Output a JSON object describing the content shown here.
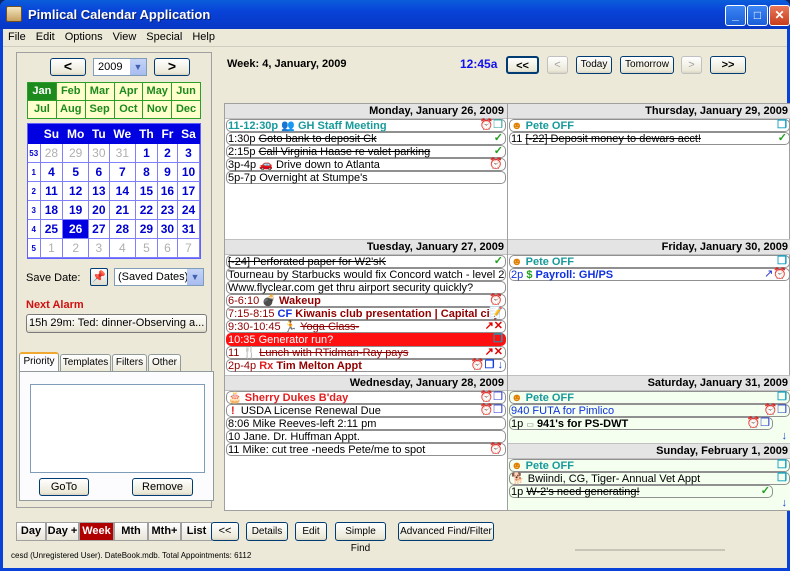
{
  "window": {
    "title": "Pimlical Calendar Application",
    "minimize": "_",
    "maximize": "□",
    "close": "✕"
  },
  "menu": [
    "File",
    "Edit",
    "Options",
    "View",
    "Special",
    "Help"
  ],
  "left": {
    "year": "2009",
    "prev": "<",
    "next": ">",
    "months": [
      "Jan",
      "Feb",
      "Mar",
      "Apr",
      "May",
      "Jun",
      "Jul",
      "Aug",
      "Sep",
      "Oct",
      "Nov",
      "Dec"
    ],
    "selected_month": "Jan",
    "weekday_headers": [
      "Su",
      "Mo",
      "Tu",
      "We",
      "Th",
      "Fr",
      "Sa"
    ],
    "weeks": [
      {
        "wk": "53",
        "days": [
          "28",
          "29",
          "30",
          "31",
          "1",
          "2",
          "3"
        ]
      },
      {
        "wk": "1",
        "days": [
          "4",
          "5",
          "6",
          "7",
          "8",
          "9",
          "10"
        ]
      },
      {
        "wk": "2",
        "days": [
          "11",
          "12",
          "13",
          "14",
          "15",
          "16",
          "17"
        ]
      },
      {
        "wk": "3",
        "days": [
          "18",
          "19",
          "20",
          "21",
          "22",
          "23",
          "24"
        ]
      },
      {
        "wk": "4",
        "days": [
          "25",
          "26",
          "27",
          "28",
          "29",
          "30",
          "31"
        ]
      },
      {
        "wk": "5",
        "days": [
          "1",
          "2",
          "3",
          "4",
          "5",
          "6",
          "7"
        ]
      }
    ],
    "selected_day": "26",
    "save_date_label": "Save Date:",
    "saved_dates": "(Saved Dates)",
    "next_alarm_label": "Next Alarm",
    "next_alarm_value": "15h 29m:  Ted: dinner-Observing a...",
    "tabs": [
      "Priority",
      "Templates",
      "Filters",
      "Other"
    ],
    "active_tab": "Priority",
    "goto": "GoTo",
    "remove": "Remove"
  },
  "header": {
    "week": "Week: 4,  January, 2009",
    "time": "12:45a",
    "nav": {
      "first": "<<",
      "prev": "<",
      "today": "Today",
      "tomorrow": "Tomorrow",
      "next": ">",
      "last": ">>"
    }
  },
  "days": {
    "mon": {
      "title": "Monday, January 26, 2009",
      "appts": [
        {
          "text": "11-12:30p 👥 GH Staff Meeting",
          "icons": "⏰❐"
        },
        {
          "time": "1:30p",
          "text": "Goto bank to deposit Ck",
          "icons": "✓"
        },
        {
          "time": "2:15p",
          "text": "Call Virginia Haase re valet parking",
          "icons": "✓"
        },
        {
          "text": "3p-4p 🚗 Drive down to Atlanta",
          "icons": "⏰"
        },
        {
          "text": "5p-7p Overnight at Stumpe's",
          "icons": ""
        }
      ]
    },
    "tue": {
      "title": "Tuesday, January 27, 2009",
      "appts": [
        {
          "text": "[-24] Perforated paper for W2'sK",
          "icons": "✓"
        },
        {
          "text": "Tourneau by Starbucks would fix Concord watch - level 2",
          "icons": ""
        },
        {
          "text": "Www.flyclear.com get thru airport security quickly?",
          "icons": ""
        },
        {
          "time": "6-6:10",
          "text": "Wakeup",
          "icons": "⏰"
        },
        {
          "time": "7:15-8:15",
          "badge": "CF",
          "text": "Kiwanis club presentation | Capital city",
          "icons": "📝"
        },
        {
          "time": "9:30-10:45",
          "text": "Yoga Class-",
          "icons": "↗✕"
        },
        {
          "text": "10:35 Generator run?",
          "icons": "❐"
        },
        {
          "time": "11",
          "text": "Lunch with RTidman-Ray pays",
          "icons": "↗✕"
        },
        {
          "time": "2p-4p",
          "badge": "Rx",
          "text": "Tim Melton Appt",
          "icons": "⏰❐ ↓"
        }
      ]
    },
    "wed": {
      "title": "Wednesday, January 28, 2009",
      "appts": [
        {
          "text": "Sherry Dukes B'day",
          "icons": "⏰❐"
        },
        {
          "text": "USDA License Renewal Due",
          "icons": "⏰❐"
        },
        {
          "text": "8:06 Mike Reeves-left 2:11 pm",
          "icons": ""
        },
        {
          "text": "10 Jane. Dr. Huffman Appt.",
          "icons": ""
        },
        {
          "text": "11 Mike: cut tree -needs Pete/me to spot",
          "icons": "⏰"
        }
      ]
    },
    "thu": {
      "title": "Thursday, January 29, 2009",
      "appts": [
        {
          "text": "Pete OFF",
          "icons": "❐"
        },
        {
          "time": "11",
          "text": "[-22] Deposit money to dewars acct!",
          "icons": "✓"
        }
      ]
    },
    "fri": {
      "title": "Friday, January 30, 2009",
      "appts": [
        {
          "text": "Pete OFF",
          "icons": "❐"
        },
        {
          "time": "2p",
          "text": "Payroll: GH/PS",
          "icons": "↗⏰"
        }
      ]
    },
    "sat": {
      "title": "Saturday, January 31, 2009",
      "appts": [
        {
          "text": "Pete OFF",
          "icons": "❐"
        },
        {
          "text": "940 FUTA for Pimlico",
          "icons": "⏰❐"
        },
        {
          "time": "1p",
          "text": "941's for PS-DWT",
          "icons": "⏰❐"
        }
      ]
    },
    "sun": {
      "title": "Sunday, February 1, 2009",
      "appts": [
        {
          "text": "Pete OFF",
          "icons": "❐"
        },
        {
          "text": "Bwiindi, CG, Tiger-  Annual Vet Appt",
          "icons": "❐"
        },
        {
          "time": "1p",
          "text": "W-2's need generating!",
          "icons": "✓"
        }
      ]
    }
  },
  "bottom": {
    "views": [
      "Day",
      "Day +",
      "Week",
      "Mth",
      "Mth+",
      "List"
    ],
    "active_view": "Week",
    "actions": [
      "<<",
      "Details",
      "Edit",
      "Simple Find",
      "Advanced Find/Filter"
    ],
    "status": "cesd (Unregistered User). DateBook.mdb. Total Appointments: 6112"
  }
}
